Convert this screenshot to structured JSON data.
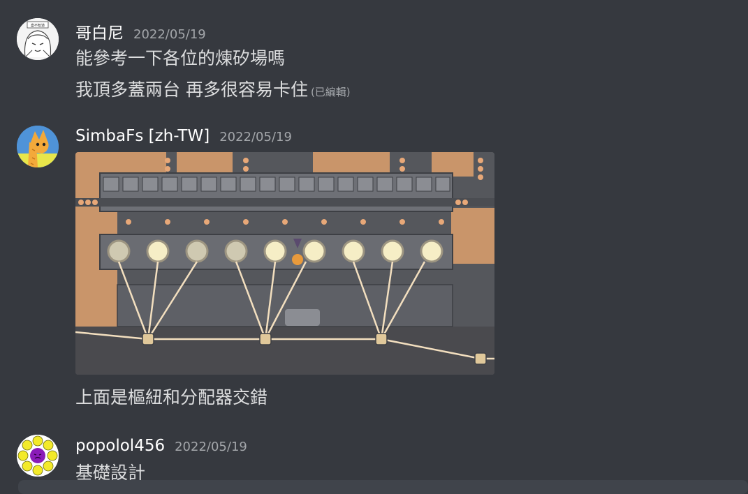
{
  "messages": [
    {
      "username": "哥白尼",
      "timestamp": "2022/05/19",
      "avatar_icon": "anime-character-avatar",
      "avatar_text": "案不知道",
      "lines": [
        "能參考一下各位的煉矽場嗎",
        "我頂多蓋兩台 再多很容易卡住"
      ],
      "edited_label": "(已編輯)"
    },
    {
      "username": "SimbaFs [zh-TW]",
      "timestamp": "2022/05/19",
      "avatar_icon": "yellow-cat-avatar",
      "attachment": "game-screenshot-silicon-smelter-layout",
      "lines": [
        "上面是樞紐和分配器交錯"
      ]
    },
    {
      "username": "popolol456",
      "timestamp": "2022/05/19",
      "avatar_icon": "purple-face-with-yellow-circles-avatar",
      "lines": [
        "基礎設計"
      ]
    }
  ],
  "colors": {
    "background": "#36393f",
    "username": "#ffffff",
    "message_text": "#dcddde",
    "timestamp": "#a3a6aa",
    "composer": "#40444b"
  }
}
